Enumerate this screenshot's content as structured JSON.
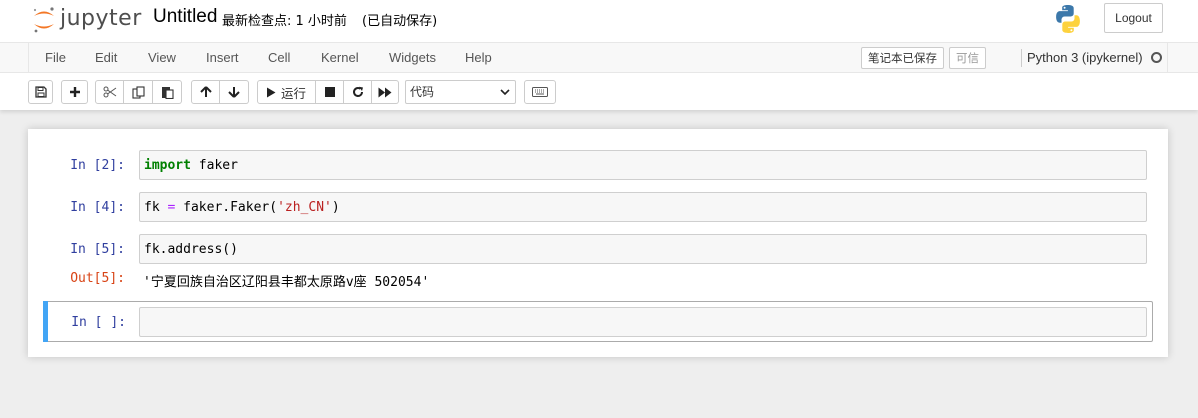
{
  "header": {
    "logo_text": "jupyter",
    "notebook_name": "Untitled",
    "checkpoint": "最新检查点: 1 小时前",
    "autosave": "(已自动保存)",
    "logout_label": "Logout"
  },
  "menubar": {
    "items": [
      "File",
      "Edit",
      "View",
      "Insert",
      "Cell",
      "Kernel",
      "Widgets",
      "Help"
    ],
    "trusted_label": "笔记本已保存",
    "trust_label": "可信",
    "kernel_name": "Python 3 (ipykernel)"
  },
  "toolbar": {
    "run_label": "运行",
    "cell_type": "代码",
    "icons": [
      "save-icon",
      "plus-icon",
      "scissors-icon",
      "copy-icon",
      "paste-icon",
      "arrow-up-icon",
      "arrow-down-icon",
      "play-icon",
      "stop-icon",
      "restart-icon",
      "fast-forward-icon",
      "chevron-down-icon",
      "keyboard-icon"
    ]
  },
  "cells": [
    {
      "prompt": "In  [2]:",
      "code": {
        "kw": "import",
        "rest": " faker"
      }
    },
    {
      "prompt": "In  [4]:",
      "code": {
        "a": "fk ",
        "op": "=",
        "b": " faker.Faker(",
        "str": "'zh_CN'",
        "c": ")"
      }
    },
    {
      "prompt": "In  [5]:",
      "code": {
        "text": "fk.address()"
      },
      "out_prompt": "Out[5]:",
      "output": "'宁夏回族自治区辽阳县丰都太原路v座 502054'"
    },
    {
      "prompt": "In  [ ]:",
      "code": {
        "text": ""
      }
    }
  ],
  "colors": {
    "prompt_in": "#303f9f",
    "prompt_out": "#d84315",
    "keyword": "#008000",
    "string": "#ba2121",
    "selected_bar": "#42a5f5",
    "logo_orange": "#f37726"
  }
}
